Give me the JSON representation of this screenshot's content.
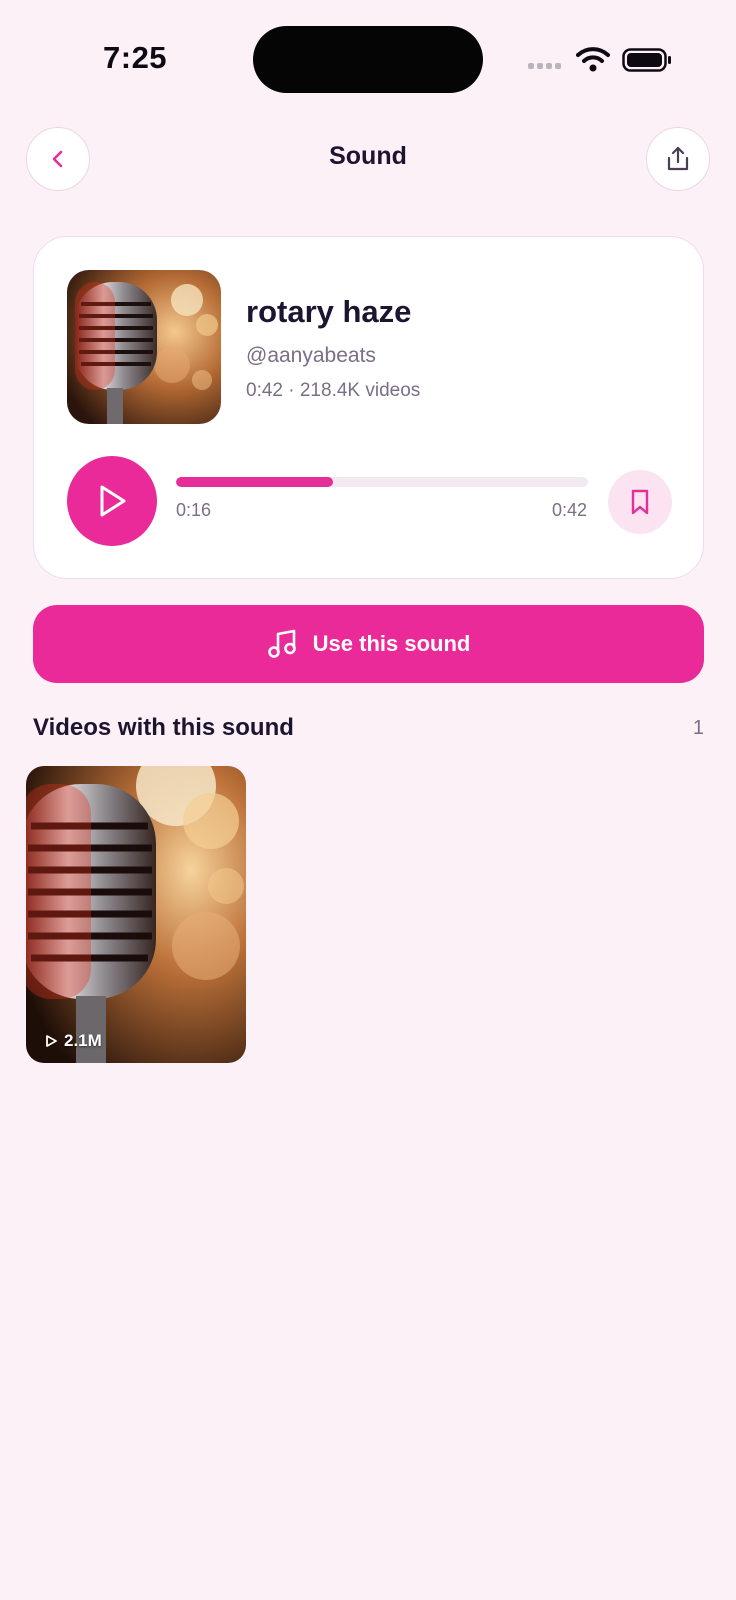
{
  "status_bar": {
    "time": "7:25"
  },
  "header": {
    "title": "Sound",
    "back_icon": "chevron-left-icon",
    "share_icon": "share-icon"
  },
  "sound": {
    "title": "rotary haze",
    "author": "@aanyabeats",
    "meta": "0:42 · 218.4K videos",
    "current_time": "0:16",
    "total_time": "0:42",
    "progress": 0.38,
    "cover_icon": "microphone-image"
  },
  "actions": {
    "use_sound_label": "Use this sound",
    "use_sound_icon": "music-note-icon",
    "bookmark_icon": "bookmark-icon",
    "play_icon": "play-icon"
  },
  "videos_section": {
    "title": "Videos with this sound",
    "count": "1",
    "items": [
      {
        "views": "2.1M"
      }
    ]
  },
  "colors": {
    "accent": "#ea2a98",
    "background": "#fdf1f8",
    "card": "#ffffff",
    "text": "#1d1530",
    "muted": "#7c6e86"
  }
}
